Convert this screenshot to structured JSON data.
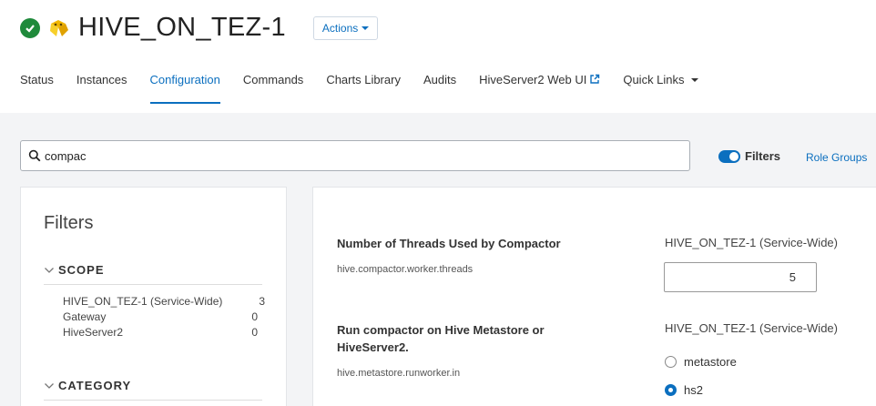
{
  "header": {
    "title": "HIVE_ON_TEZ-1",
    "actions_label": "Actions",
    "status_icon": "check-circle-icon",
    "logo_icon": "hive-bee-icon"
  },
  "tabs": [
    {
      "label": "Status"
    },
    {
      "label": "Instances"
    },
    {
      "label": "Configuration",
      "active": true
    },
    {
      "label": "Commands"
    },
    {
      "label": "Charts Library"
    },
    {
      "label": "Audits"
    },
    {
      "label": "HiveServer2 Web UI",
      "icon": "external-link-icon"
    },
    {
      "label": "Quick Links",
      "icon": "caret-down-icon"
    }
  ],
  "search": {
    "value": "compac",
    "icon": "search-icon"
  },
  "filters_toggle": {
    "label": "Filters",
    "on": true
  },
  "role_groups_label": "Role Groups",
  "filters_panel": {
    "title": "Filters",
    "scope": {
      "label": "SCOPE",
      "items": [
        {
          "label": "HIVE_ON_TEZ-1 (Service-Wide)",
          "count": "3"
        },
        {
          "label": "Gateway",
          "count": "0"
        },
        {
          "label": "HiveServer2",
          "count": "0"
        }
      ]
    },
    "category": {
      "label": "CATEGORY"
    }
  },
  "configs": [
    {
      "name": "Number of Threads Used by Compactor",
      "key": "hive.compactor.worker.threads",
      "scope": "HIVE_ON_TEZ-1 (Service-Wide)",
      "value": "5"
    },
    {
      "name_line1": "Run compactor on Hive Metastore or",
      "name_line2": "HiveServer2.",
      "key": "hive.metastore.runworker.in",
      "scope": "HIVE_ON_TEZ-1 (Service-Wide)",
      "options": [
        {
          "label": "metastore",
          "selected": false
        },
        {
          "label": "hs2",
          "selected": true
        }
      ]
    }
  ],
  "colors": {
    "accent": "#0b6fbf",
    "status_ok": "#1f8a3b"
  }
}
